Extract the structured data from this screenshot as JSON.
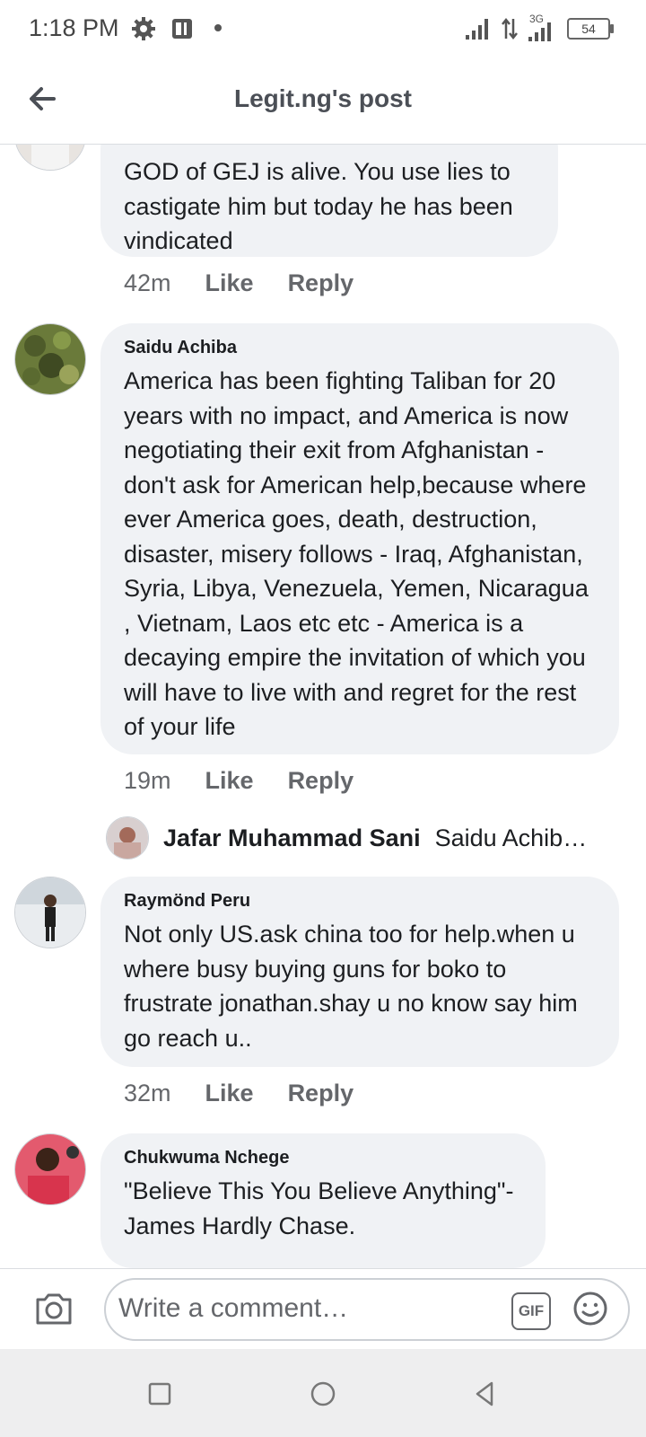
{
  "status_bar": {
    "time": "1:18 PM",
    "network": "3G",
    "battery": "54",
    "icons": [
      "gear-icon",
      "pdf-icon",
      "dot-icon",
      "signal-icon",
      "data-arrows-icon",
      "signal-3g-icon",
      "battery-icon"
    ]
  },
  "header": {
    "title": "Legit.ng's post",
    "back_icon": "arrow-left-icon"
  },
  "comments": [
    {
      "author": "",
      "text": "GOD of GEJ is alive. You use lies to castigate him but today  he has been vindicated",
      "time": "42m",
      "like": "Like",
      "reply": "Reply"
    },
    {
      "author": "Saidu Achiba",
      "text": "America has been fighting Taliban for 20 years with no impact, and America is now negotiating their exit from Afghanistan - don't ask for American help,because where ever America goes, death, destruction, disaster, misery follows - Iraq, Afghanistan, Syria, Libya, Venezuela, Yemen, Nicaragua , Vietnam, Laos etc etc - America is a decaying empire the invitation of which you will have to live with and regret for the rest of your life",
      "time": "19m",
      "like": "Like",
      "reply": "Reply",
      "reply_preview": {
        "name": "Jafar Muhammad Sani",
        "text": "Saidu Achib…"
      }
    },
    {
      "author": "Raymönd Peru",
      "text": "Not only US.ask china too for help.when u where busy buying guns for boko to frustrate jonathan.shay u no know say him go reach u..",
      "time": "32m",
      "like": "Like",
      "reply": "Reply"
    },
    {
      "author": "Chukwuma Nchege",
      "text": "\"Believe This You Believe Anything\"- James Hardly Chase."
    }
  ],
  "composer": {
    "placeholder": "Write a comment…",
    "gif_label": "GIF",
    "icons": [
      "camera-icon",
      "gif-icon",
      "emoji-icon"
    ]
  },
  "navbar": {
    "icons": [
      "recents-square-icon",
      "home-circle-icon",
      "back-triangle-icon"
    ]
  }
}
